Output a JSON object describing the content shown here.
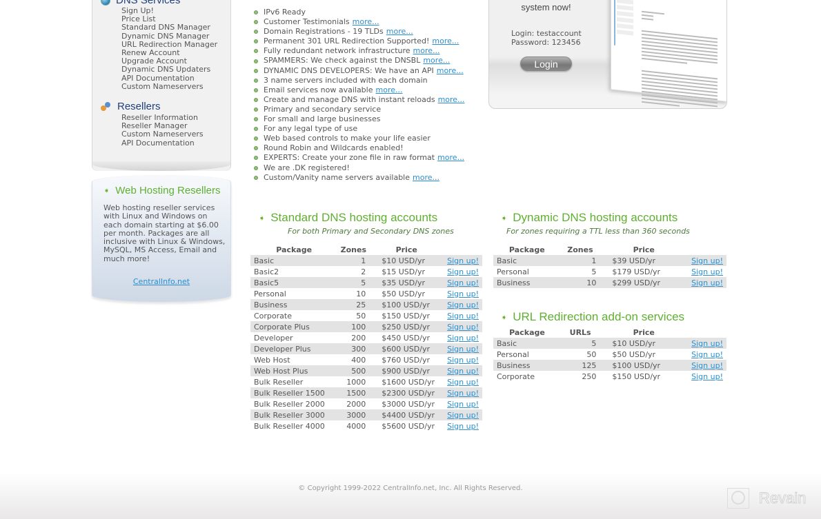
{
  "sidebar": {
    "dns_services": {
      "title": "DNS Services",
      "icon": "globe-icon",
      "items": [
        "Sign Up!",
        "Price List",
        "Standard DNS Manager",
        "Dynamic DNS Manager",
        "URL Redirection Manager",
        "Renew Account",
        "Upgrade Account",
        "Dynamic DNS Updaters",
        "API Documentation",
        "Custom Nameservers"
      ]
    },
    "resellers": {
      "title": "Resellers",
      "icon": "users-icon",
      "items": [
        "Reseller Information",
        "Reseller Manager",
        "Custom Nameservers",
        "API Documentation"
      ]
    },
    "web_hosting": {
      "title": "Web Hosting Resellers",
      "icon": "arrow-right-icon",
      "text": "Web hosting reseller services with Linux and Windows on each domain starting at $6.00 per month. Packages are all inclusive with Linux & Windows, MySQL, MS Access, Email and much more!",
      "link": "CentralInfo.net"
    }
  },
  "features": [
    {
      "text": "IPv6 Ready",
      "more": null
    },
    {
      "text": "Customer Testimonials",
      "more": "more..."
    },
    {
      "text": "Domain Registrations - 19 TLDs",
      "more": "more..."
    },
    {
      "text": "Permanent 301 URL Redirection Supported!",
      "more": "more..."
    },
    {
      "text": "Fully redundant network infrastructure",
      "more": "more..."
    },
    {
      "text": "SPAMMERS: We check against the DNSBL",
      "more": "more..."
    },
    {
      "text": "DYNAMIC DNS DEVELOPERS: We have an API",
      "more": "more..."
    },
    {
      "text": "3 name servers included with each domain",
      "more": null
    },
    {
      "text": "Email services now available",
      "more": "more..."
    },
    {
      "text": "Create and manage DNS with instant reloads",
      "more": "more..."
    },
    {
      "text": "Primary and secondary service",
      "more": null
    },
    {
      "text": "For small and large businesses",
      "more": null
    },
    {
      "text": "For any legal type of use",
      "more": null
    },
    {
      "text": "Web based controls to make your life easier",
      "more": null
    },
    {
      "text": "Round Robin and Wildcards enabled!",
      "more": null
    },
    {
      "text": "EXPERTS: Create your zone file in raw format",
      "more": "more..."
    },
    {
      "text": "We are .DK registered!",
      "more": null
    },
    {
      "text": "Custom/Vanity name servers available",
      "more": "more..."
    }
  ],
  "demo": {
    "text": "system now!",
    "login_line": "Login: testaccount",
    "password_line": "Password: 123456",
    "login_button": "Login"
  },
  "standard": {
    "title": "Standard DNS hosting accounts",
    "subtitle": "For both Primary and Secondary DNS zones",
    "headers": [
      "Package",
      "Zones",
      "Price"
    ],
    "signup_label": "Sign up!",
    "rows": [
      [
        "Basic",
        "1",
        "$10 USD/yr"
      ],
      [
        "Basic2",
        "2",
        "$15 USD/yr"
      ],
      [
        "Basic5",
        "5",
        "$35 USD/yr"
      ],
      [
        "Personal",
        "10",
        "$50 USD/yr"
      ],
      [
        "Business",
        "25",
        "$100 USD/yr"
      ],
      [
        "Corporate",
        "50",
        "$150 USD/yr"
      ],
      [
        "Corporate Plus",
        "100",
        "$250 USD/yr"
      ],
      [
        "Developer",
        "200",
        "$450 USD/yr"
      ],
      [
        "Developer Plus",
        "300",
        "$600 USD/yr"
      ],
      [
        "Web Host",
        "400",
        "$760 USD/yr"
      ],
      [
        "Web Host Plus",
        "500",
        "$900 USD/yr"
      ],
      [
        "Bulk Reseller",
        "1000",
        "$1600 USD/yr"
      ],
      [
        "Bulk Reseller 1500",
        "1500",
        "$2300 USD/yr"
      ],
      [
        "Bulk Reseller 2000",
        "2000",
        "$3000 USD/yr"
      ],
      [
        "Bulk Reseller 3000",
        "3000",
        "$4400 USD/yr"
      ],
      [
        "Bulk Reseller 4000",
        "4000",
        "$5600 USD/yr"
      ]
    ]
  },
  "dynamic": {
    "title": "Dynamic DNS hosting accounts",
    "subtitle": "For zones requiring a TTL less than 360 seconds",
    "headers": [
      "Package",
      "Zones",
      "Price"
    ],
    "signup_label": "Sign up!",
    "rows": [
      [
        "Basic",
        "1",
        "$39 USD/yr"
      ],
      [
        "Personal",
        "5",
        "$179 USD/yr"
      ],
      [
        "Business",
        "10",
        "$299 USD/yr"
      ]
    ]
  },
  "url_redirection": {
    "title": "URL Redirection add-on services",
    "headers": [
      "Package",
      "URLs",
      "Price"
    ],
    "signup_label": "Sign up!",
    "rows": [
      [
        "Basic",
        "5",
        "$10 USD/yr"
      ],
      [
        "Personal",
        "50",
        "$50 USD/yr"
      ],
      [
        "Business",
        "125",
        "$100 USD/yr"
      ],
      [
        "Corporate",
        "250",
        "$150 USD/yr"
      ]
    ]
  },
  "footer": {
    "copyright": "© Copyright 1999-2022 CentralInfo.net, Inc. All Rights Reserved."
  },
  "watermark": {
    "label": "Revain",
    "icon": "revain-logo-icon"
  },
  "colors": {
    "accent_green": "#5fb030",
    "link_blue": "#2a8ed1",
    "nav_title_blue": "#1f3f7a",
    "row_stripe": "#e3e3e3"
  }
}
